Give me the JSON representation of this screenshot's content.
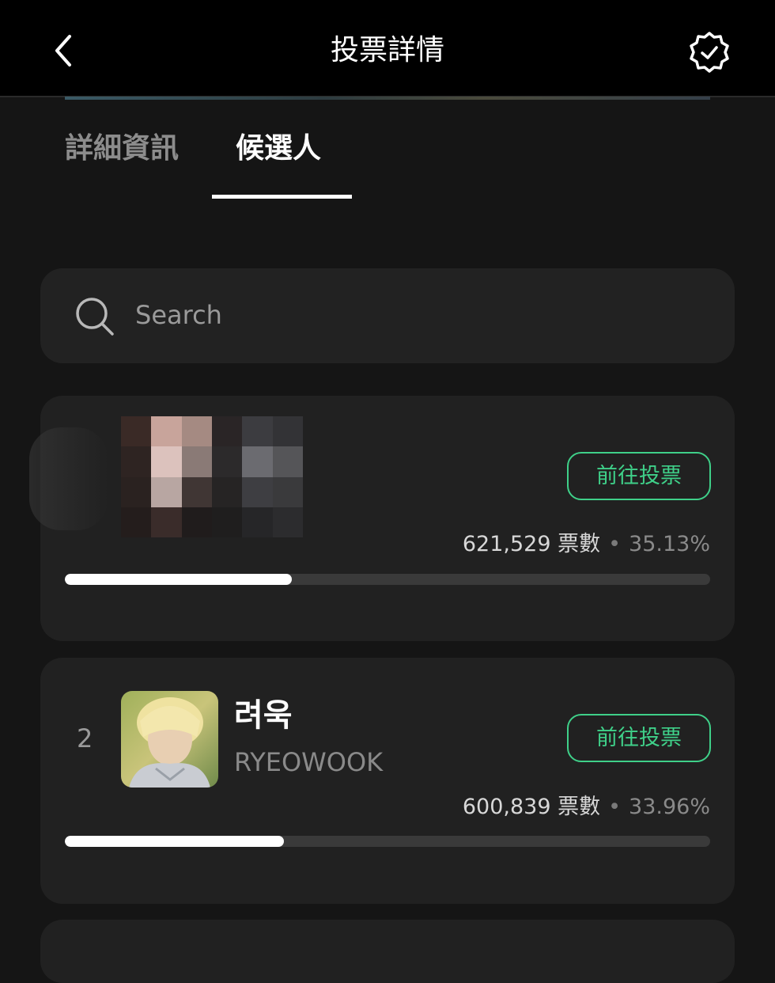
{
  "header": {
    "title": "投票詳情",
    "back_icon": "chevron-left-icon",
    "verify_icon": "verified-badge-icon"
  },
  "tabs": [
    {
      "label": "詳細資訊",
      "active": false
    },
    {
      "label": "候選人",
      "active": true
    }
  ],
  "search": {
    "placeholder": "Search",
    "value": ""
  },
  "candidates": [
    {
      "rank": "",
      "name": "",
      "name_en": "",
      "vote_button": "前往投票",
      "votes": "621,529 票數",
      "percent": "35.13%",
      "progress": 0.3513,
      "avatar_hidden": true
    },
    {
      "rank": "2",
      "name": "려욱",
      "name_en": "RYEOWOOK",
      "vote_button": "前往投票",
      "votes": "600,839 票數",
      "percent": "33.96%",
      "progress": 0.3396,
      "avatar_hidden": false
    }
  ],
  "separator": "•",
  "colors": {
    "background": "#151515",
    "card": "#212121",
    "accent_green": "#3fd089",
    "progress_fill": "#ffffff",
    "progress_track": "#3a3a3a"
  }
}
